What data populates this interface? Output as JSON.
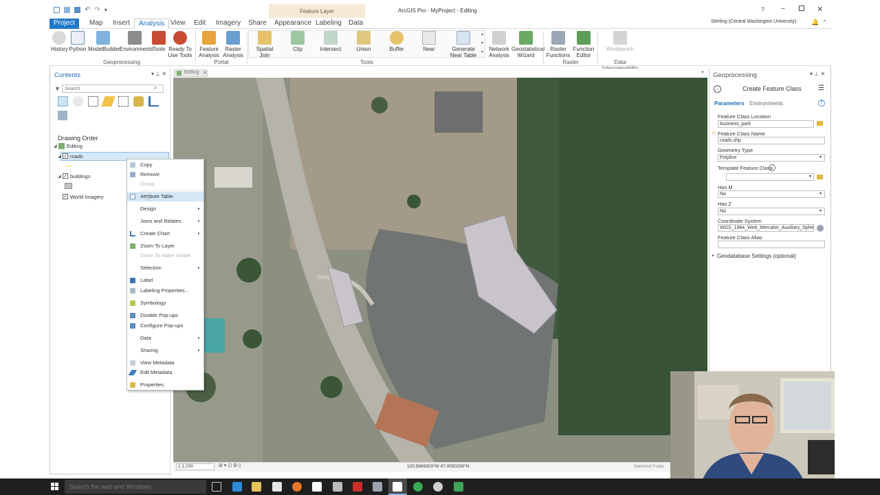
{
  "window": {
    "app_title": "ArcGIS Pro - MyProject - Editing",
    "context_tab_group": "Feature Layer",
    "help": "?",
    "user": "Sterling (Central Washington University)"
  },
  "ribbon_tabs": [
    "Project",
    "Map",
    "Insert",
    "Analysis",
    "View",
    "Edit",
    "Imagery",
    "Share",
    "Appearance",
    "Labeling",
    "Data"
  ],
  "active_tab": "Analysis",
  "ribbon": {
    "geoprocessing": {
      "label": "Geoprocessing",
      "buttons": [
        "History",
        "Python",
        "ModelBuilder",
        "Environments",
        "Tools",
        "Ready To Use Tools"
      ]
    },
    "portal": {
      "label": "Portal",
      "buttons": [
        "Feature Analysis",
        "Raster Analysis"
      ]
    },
    "tools": {
      "label": "Tools",
      "buttons": [
        "Spatial Join",
        "Clip",
        "Intersect",
        "Union",
        "Buffer",
        "Near",
        "Generate Near Table"
      ]
    },
    "raster_group": {
      "label": "",
      "buttons": [
        "Network Analysis",
        "Geostatistical Wizard"
      ]
    },
    "raster": {
      "label": "Raster",
      "buttons": [
        "Raster Functions",
        "Function Editor"
      ]
    },
    "interop": {
      "label": "Data Interoperability",
      "buttons": [
        "Workbench"
      ]
    }
  },
  "contents": {
    "title": "Contents",
    "search_placeholder": "Search",
    "drawing_order": "Drawing Order",
    "layers": [
      {
        "name": "Editing"
      },
      {
        "name": "roads",
        "checked": true
      },
      {
        "name": "buildings",
        "checked": true
      },
      {
        "name": "World Imagery",
        "checked": true
      }
    ]
  },
  "map_tab": {
    "title": "Editing"
  },
  "status": {
    "scale": "1:1,230",
    "coordinates": "120.5869303°W 47.0050258°N",
    "selected": "Selected Featu"
  },
  "context_menu": [
    {
      "label": "Copy",
      "disabled": false,
      "submenu": false
    },
    {
      "label": "Remove",
      "disabled": false,
      "submenu": false
    },
    {
      "label": "Group",
      "disabled": true,
      "submenu": false
    },
    {
      "label": "Attribute Table",
      "disabled": false,
      "submenu": false,
      "hover": true
    },
    {
      "label": "Design",
      "disabled": false,
      "submenu": true
    },
    {
      "label": "Joins and Relates",
      "disabled": false,
      "submenu": true
    },
    {
      "label": "Create Chart",
      "disabled": false,
      "submenu": true
    },
    {
      "label": "Zoom To Layer",
      "disabled": false,
      "submenu": false
    },
    {
      "label": "Zoom To Make Visible",
      "disabled": true,
      "submenu": false
    },
    {
      "label": "Selection",
      "disabled": false,
      "submenu": true
    },
    {
      "label": "Label",
      "disabled": false,
      "submenu": false
    },
    {
      "label": "Labeling Properties...",
      "disabled": false,
      "submenu": false
    },
    {
      "label": "Symbology",
      "disabled": false,
      "submenu": false
    },
    {
      "label": "Disable Pop-ups",
      "disabled": false,
      "submenu": false
    },
    {
      "label": "Configure Pop-ups",
      "disabled": false,
      "submenu": false
    },
    {
      "label": "Data",
      "disabled": false,
      "submenu": true
    },
    {
      "label": "Sharing",
      "disabled": false,
      "submenu": true
    },
    {
      "label": "View Metadata",
      "disabled": false,
      "submenu": false
    },
    {
      "label": "Edit Metadata",
      "disabled": false,
      "submenu": false
    },
    {
      "label": "Properties",
      "disabled": false,
      "submenu": false
    }
  ],
  "geoprocessing": {
    "pane_title": "Geoprocessing",
    "tool_title": "Create Feature Class",
    "tabs": [
      "Parameters",
      "Environments"
    ],
    "fields": {
      "location_label": "Feature Class Location",
      "location_value": "business_park",
      "name_label": "Feature Class Name",
      "name_value": "roads.shp",
      "geometry_label": "Geometry Type",
      "geometry_value": "Polyline",
      "template_label": "Template Feature Class",
      "template_value": "",
      "hasm_label": "Has M",
      "hasm_value": "No",
      "hasz_label": "Has Z",
      "hasz_value": "No",
      "cs_label": "Coordinate System",
      "cs_value": "WGS_1984_Web_Mercator_Auxiliary_Sphe",
      "alias_label": "Feature Class Alias",
      "alias_value": ""
    },
    "geodatabase_settings": "Geodatabase Settings (optional)"
  },
  "taskbar": {
    "search_placeholder": "Search the web and Windows"
  },
  "colors": {
    "accent": "#1f78c8",
    "context_band": "#f6ead6",
    "taskbar": "#1e1e1e"
  }
}
